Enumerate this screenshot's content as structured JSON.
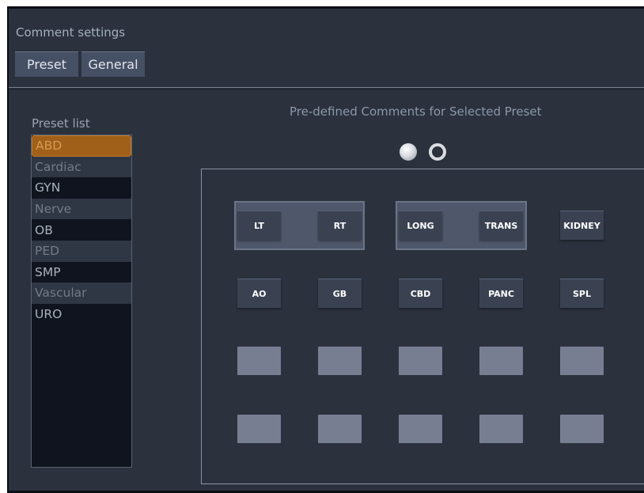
{
  "header": {
    "title": "Comment settings",
    "tabs": [
      {
        "label": "Preset"
      },
      {
        "label": "General"
      }
    ]
  },
  "preset_list": {
    "label": "Preset list",
    "items": [
      "ABD",
      "Cardiac",
      "GYN",
      "Nerve",
      "OB",
      "PED",
      "SMP",
      "Vascular",
      "URO"
    ],
    "selected": "ABD"
  },
  "comments": {
    "title": "Pre-defined Comments for Selected Preset",
    "page_indicator": {
      "pages": 2,
      "current": 1
    },
    "buttons": [
      "LT",
      "RT",
      "LONG",
      "TRANS",
      "KIDNEY",
      "AO",
      "GB",
      "CBD",
      "PANC",
      "SPL"
    ],
    "empty_slots": 10
  },
  "colors": {
    "background": "#2b323e",
    "selected_preset": "#a0601a",
    "button": "#3a4252",
    "empty_slot": "#787e92"
  }
}
